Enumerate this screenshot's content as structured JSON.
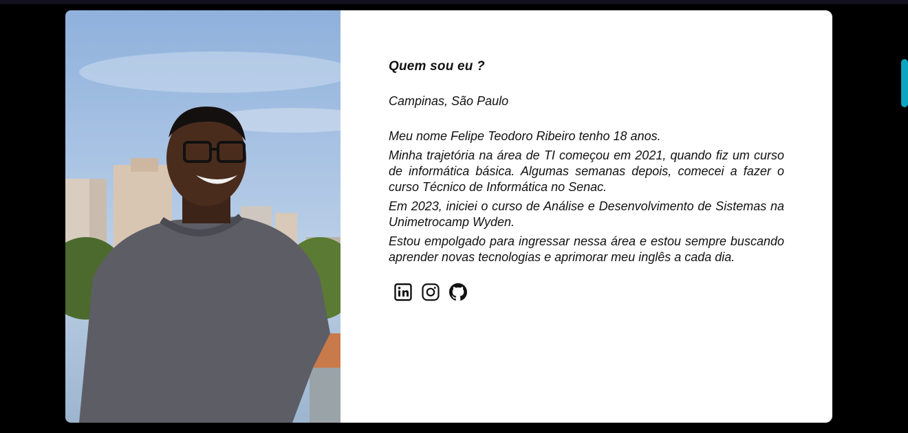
{
  "about": {
    "heading": "Quem sou eu ?",
    "location": "Campinas, São Paulo",
    "paragraphs": [
      "Meu nome Felipe Teodoro Ribeiro tenho 18 anos.",
      "Minha trajetória na área de TI começou em 2021, quando fiz um curso de informática básica. Algumas semanas depois, comecei a fazer o curso Técnico de Informática no Senac.",
      "Em 2023, iniciei o curso de Análise e Desenvolvimento de Sistemas na Unimetrocamp Wyden.",
      "Estou empolgado para ingressar nessa área e estou sempre buscando aprender novas tecnologias e aprimorar meu inglês a cada dia."
    ]
  },
  "socials": [
    {
      "icon": "linkedin-icon"
    },
    {
      "icon": "instagram-icon"
    },
    {
      "icon": "github-icon"
    }
  ],
  "colors": {
    "page_background": "#000000",
    "card_background": "#ffffff",
    "text": "#111111",
    "scrollbar_accent": "#0ea5c0"
  }
}
